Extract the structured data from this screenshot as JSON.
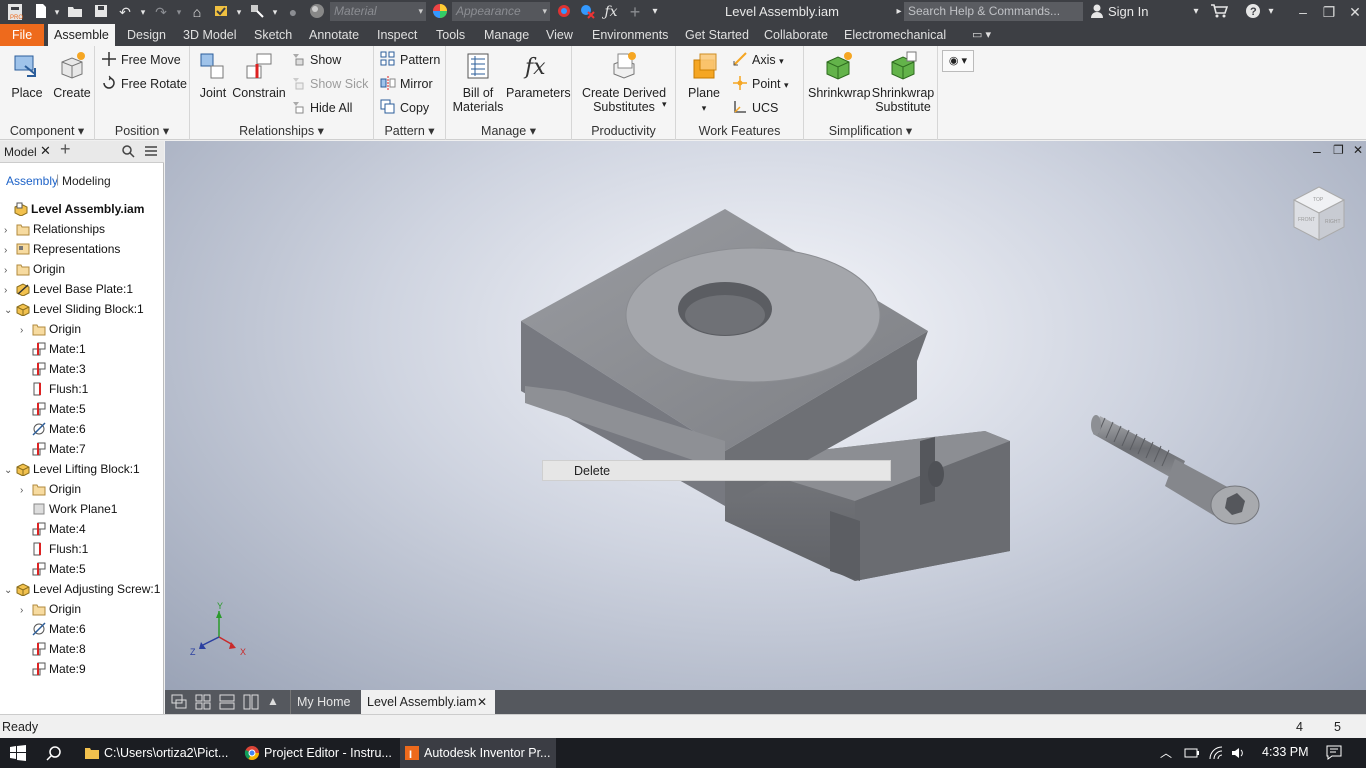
{
  "titlebar": {
    "material_placeholder": "Material",
    "appearance_placeholder": "Appearance",
    "document_title": "Level Assembly.iam",
    "search_placeholder": "Search Help & Commands...",
    "sign_in": "Sign In"
  },
  "ribbon_tabs": [
    "File",
    "Assemble",
    "Design",
    "3D Model",
    "Sketch",
    "Annotate",
    "Inspect",
    "Tools",
    "Manage",
    "View",
    "Environments",
    "Get Started",
    "Collaborate",
    "Electromechanical"
  ],
  "active_tab": "Assemble",
  "ribbon": {
    "component": {
      "title": "Component",
      "place": "Place",
      "create": "Create"
    },
    "position": {
      "title": "Position",
      "free_move": "Free Move",
      "free_rotate": "Free Rotate"
    },
    "relationships": {
      "title": "Relationships",
      "joint": "Joint",
      "constrain": "Constrain",
      "show": "Show",
      "show_sick": "Show Sick",
      "hide_all": "Hide All"
    },
    "pattern": {
      "title": "Pattern",
      "pattern": "Pattern",
      "mirror": "Mirror",
      "copy": "Copy"
    },
    "manage": {
      "title": "Manage",
      "bom_line1": "Bill of",
      "bom_line2": "Materials",
      "parameters": "Parameters"
    },
    "productivity": {
      "title": "Productivity",
      "cds_line1": "Create Derived",
      "cds_line2": "Substitutes"
    },
    "work_features": {
      "title": "Work Features",
      "plane": "Plane",
      "axis": "Axis",
      "point": "Point",
      "ucs": "UCS"
    },
    "simplification": {
      "title": "Simplification",
      "shrinkwrap": "Shrinkwrap",
      "sws_line1": "Shrinkwrap",
      "sws_line2": "Substitute"
    }
  },
  "browser": {
    "title": "Model",
    "tab_assembly": "Assembly",
    "tab_modeling": "Modeling",
    "items": [
      {
        "label": "Level Assembly.iam",
        "indent": 0,
        "bold": true,
        "icon": "assembly",
        "toggle": ""
      },
      {
        "label": "Relationships",
        "indent": 1,
        "icon": "folder",
        "toggle": ">"
      },
      {
        "label": "Representations",
        "indent": 1,
        "icon": "representations",
        "toggle": ">"
      },
      {
        "label": "Origin",
        "indent": 1,
        "icon": "folder",
        "toggle": ">"
      },
      {
        "label": "Level Base Plate:1",
        "indent": 1,
        "icon": "grounded-part",
        "toggle": ">"
      },
      {
        "label": "Level Sliding Block:1",
        "indent": 1,
        "icon": "part",
        "toggle": "v"
      },
      {
        "label": "Origin",
        "indent": 2,
        "icon": "folder",
        "toggle": ">"
      },
      {
        "label": "Mate:1",
        "indent": 2,
        "icon": "mate",
        "toggle": ""
      },
      {
        "label": "Mate:3",
        "indent": 2,
        "icon": "mate",
        "toggle": ""
      },
      {
        "label": "Flush:1",
        "indent": 2,
        "icon": "flush",
        "toggle": ""
      },
      {
        "label": "Mate:5",
        "indent": 2,
        "icon": "mate",
        "toggle": ""
      },
      {
        "label": "Mate:6",
        "indent": 2,
        "icon": "mate-axis",
        "toggle": ""
      },
      {
        "label": "Mate:7",
        "indent": 2,
        "icon": "mate",
        "toggle": ""
      },
      {
        "label": "Level Lifting Block:1",
        "indent": 1,
        "icon": "part",
        "toggle": "v"
      },
      {
        "label": "Origin",
        "indent": 2,
        "icon": "folder",
        "toggle": ">"
      },
      {
        "label": "Work Plane1",
        "indent": 2,
        "icon": "workplane",
        "toggle": ""
      },
      {
        "label": "Mate:4",
        "indent": 2,
        "icon": "mate",
        "toggle": ""
      },
      {
        "label": "Flush:1",
        "indent": 2,
        "icon": "flush",
        "toggle": ""
      },
      {
        "label": "Mate:5",
        "indent": 2,
        "icon": "mate",
        "toggle": ""
      },
      {
        "label": "Level Adjusting Screw:1",
        "indent": 1,
        "icon": "part",
        "toggle": "v"
      },
      {
        "label": "Origin",
        "indent": 2,
        "icon": "folder",
        "toggle": ">"
      },
      {
        "label": "Mate:6",
        "indent": 2,
        "icon": "mate-axis",
        "toggle": ""
      },
      {
        "label": "Mate:8",
        "indent": 2,
        "icon": "mate",
        "toggle": ""
      },
      {
        "label": "Mate:9",
        "indent": 2,
        "icon": "mate",
        "toggle": ""
      }
    ]
  },
  "viewport": {
    "context_menu_item": "Delete",
    "viewcube_top": "TOP",
    "viewcube_front": "FRONT",
    "viewcube_right": "RIGHT",
    "triad_x": "X",
    "triad_y": "Y",
    "triad_z": "Z"
  },
  "doc_tabs": {
    "home": "My Home",
    "active": "Level Assembly.iam"
  },
  "statusbar": {
    "status": "Ready",
    "count1": "4",
    "count2": "5"
  },
  "taskbar": {
    "item1": "C:\\Users\\ortiza2\\Pict...",
    "item2": "Project Editor - Instru...",
    "item3": "Autodesk Inventor Pr...",
    "time": "4:33 PM"
  },
  "colors": {
    "file_tab": "#ee6a1c",
    "titlebar": "#3d3f44",
    "accent_blue": "#1e63c8"
  }
}
